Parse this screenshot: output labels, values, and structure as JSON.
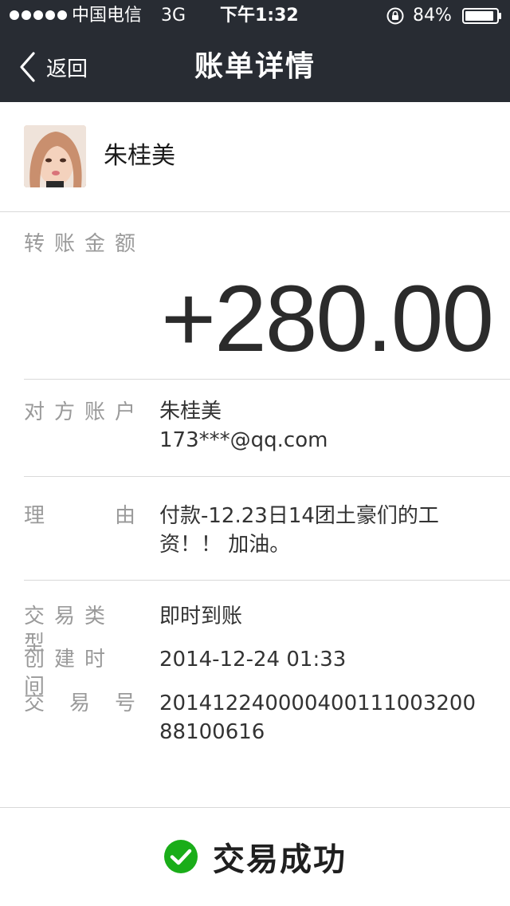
{
  "status_bar": {
    "carrier": "中国电信",
    "network": "3G",
    "time": "下午1:32",
    "battery": "84%",
    "icons": [
      "signal-dots-icon",
      "orientation-lock-icon",
      "battery-icon"
    ]
  },
  "nav": {
    "back_label": "返回",
    "title": "账单详情",
    "icons": [
      "chevron-left-icon"
    ]
  },
  "payer": {
    "name": "朱桂美",
    "avatar": "avatar-photo"
  },
  "amount": {
    "label": "转账金额",
    "value": "+280.00"
  },
  "counterparty": {
    "label_chars": [
      "对",
      "方",
      "账",
      "户"
    ],
    "name": "朱桂美",
    "account": "173***@qq.com"
  },
  "reason": {
    "label_chars": [
      "理",
      "由"
    ],
    "text": "付款-12.23日14团土豪们的工资！！ 加油。"
  },
  "details": {
    "type_label": "交易类型",
    "type_value": "即时到账",
    "created_label": "创建时间",
    "created_value": "2014-12-24 01:33",
    "txn_label_chars": [
      "交",
      "易",
      "号"
    ],
    "txn_value": "20141224000040011100320088100616"
  },
  "footer": {
    "status": "交易成功",
    "icon": "check-circle-icon",
    "accent": "#1aad19"
  },
  "colors": {
    "header_bg": "#282c33",
    "label": "#9a9a9a",
    "value": "#333333",
    "divider": "#d9d9d9"
  }
}
